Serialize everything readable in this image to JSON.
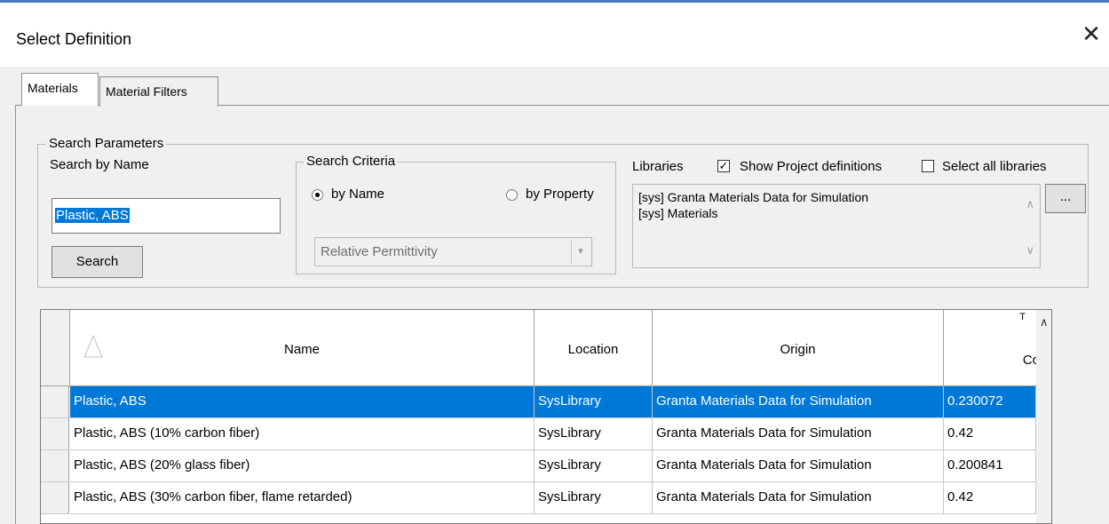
{
  "window": {
    "title": "Select Definition",
    "close_glyph": "✕"
  },
  "tabs": [
    {
      "label": "Materials",
      "active": true
    },
    {
      "label": "Material Filters",
      "active": false
    }
  ],
  "search_parameters": {
    "legend": "Search Parameters",
    "search_by_name_label": "Search by Name",
    "name_value": "Plastic, ABS",
    "search_button": "Search"
  },
  "search_criteria": {
    "legend": "Search Criteria",
    "by_name_label": "by Name",
    "by_property_label": "by Property",
    "selected": "by Name",
    "property_select_value": "Relative Permittivity"
  },
  "libraries": {
    "label": "Libraries",
    "show_project_label": "Show Project definitions",
    "show_project_checked": true,
    "select_all_label": "Select all libraries",
    "select_all_checked": false,
    "items": [
      "[sys] Granta Materials Data for Simulation",
      "[sys] Materials"
    ],
    "browse_button": "..."
  },
  "table": {
    "columns": {
      "name": "Name",
      "location": "Location",
      "origin": "Origin",
      "partial": "Co",
      "partial_top": "T"
    },
    "rows": [
      {
        "name": "Plastic, ABS",
        "location": "SysLibrary",
        "origin": "Granta Materials Data for Simulation",
        "value": "0.230072",
        "selected": true
      },
      {
        "name": "Plastic, ABS (10% carbon fiber)",
        "location": "SysLibrary",
        "origin": "Granta Materials Data for Simulation",
        "value": "0.42",
        "selected": false
      },
      {
        "name": "Plastic, ABS (20% glass fiber)",
        "location": "SysLibrary",
        "origin": "Granta Materials Data for Simulation",
        "value": "0.200841",
        "selected": false
      },
      {
        "name": "Plastic, ABS (30% carbon fiber, flame retarded)",
        "location": "SysLibrary",
        "origin": "Granta Materials Data for Simulation",
        "value": "0.42",
        "selected": false
      }
    ]
  },
  "colors": {
    "selection": "#0078d7",
    "accent_line": "#4a78b8"
  }
}
